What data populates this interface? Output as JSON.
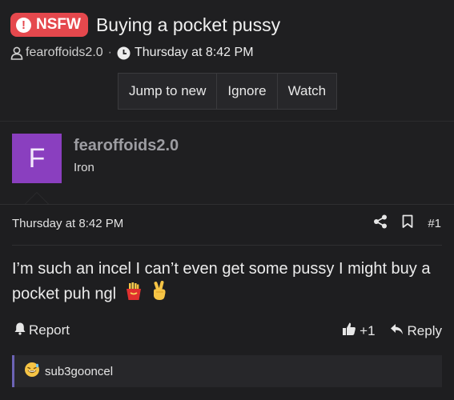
{
  "thread": {
    "badge": "NSFW",
    "badge_icon": "!",
    "title": "Buying a pocket pussy",
    "author": "fearoffoids2.0",
    "separator": "·",
    "time": "Thursday at 8:42 PM"
  },
  "actions": {
    "jump_to_new": "Jump to new",
    "ignore": "Ignore",
    "watch": "Watch"
  },
  "post": {
    "avatar_letter": "F",
    "username": "fearoffoids2.0",
    "rank": "Iron",
    "date": "Thursday at 8:42 PM",
    "number": "#1",
    "text": "I’m such an incel I can’t even get some pussy I might buy a pocket puh ngl",
    "emojis": [
      "fries-emoji",
      "victory-hand-emoji"
    ],
    "report_label": "Report",
    "like_count": "+1",
    "reply_label": "Reply"
  },
  "quote": {
    "user": "sub3gooncel",
    "emoji": "grinning-sweat-emoji"
  },
  "colors": {
    "background": "#1e1e20",
    "nsfw_red": "#e5484d",
    "avatar_purple": "#8a3fbf",
    "quote_accent": "#6c63b5"
  }
}
